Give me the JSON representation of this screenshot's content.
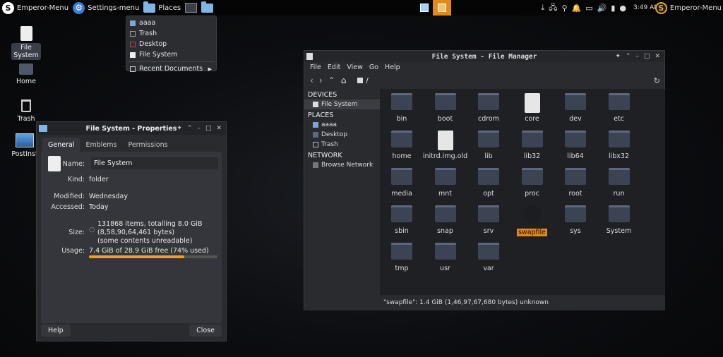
{
  "panel": {
    "emperor_menu_left": "Emperor-Menu",
    "settings_menu": "Settings-menu",
    "places": "Places",
    "clock": "3:49 AM",
    "emperor_menu_right": "Emperor-Menu",
    "accent": "#e08a1e"
  },
  "places_menu": {
    "items": [
      "aaaa",
      "Trash",
      "Desktop",
      "File System"
    ],
    "recent": "Recent Documents"
  },
  "desktop": {
    "icons": [
      "File System",
      "Home",
      "Trash",
      "PostInst"
    ]
  },
  "props": {
    "title": "File System - Properties",
    "tabs": [
      "General",
      "Emblems",
      "Permissions"
    ],
    "name_label": "Name:",
    "name_value": "File System",
    "kind_label": "Kind:",
    "kind_value": "folder",
    "modified_label": "Modified:",
    "modified_value": "Wednesday",
    "accessed_label": "Accessed:",
    "accessed_value": "Today",
    "size_label": "Size:",
    "size_line1": "131868 items, totalling 8.0 GiB",
    "size_line2": "(8,58,90,64,461 bytes)",
    "size_line3": "(some contents unreadable)",
    "usage_label": "Usage:",
    "usage_value": "7.4 GiB of 28.9 GiB free (74% used)",
    "usage_fraction": 0.74,
    "help": "Help",
    "close": "Close"
  },
  "fm": {
    "title": "File System - File Manager",
    "menus": [
      "File",
      "Edit",
      "View",
      "Go",
      "Help"
    ],
    "path": "/",
    "sidebar": {
      "devices_header": "DEVICES",
      "file_system": "File System",
      "places_header": "PLACES",
      "aaaa": "aaaa",
      "desktop": "Desktop",
      "trash": "Trash",
      "network_header": "NETWORK",
      "browse_network": "Browse Network"
    },
    "items": [
      "bin",
      "boot",
      "cdrom",
      "core",
      "dev",
      "etc",
      "home",
      "initrd.img.old",
      "lib",
      "lib32",
      "lib64",
      "libx32",
      "media",
      "mnt",
      "opt",
      "proc",
      "root",
      "run",
      "sbin",
      "snap",
      "srv",
      "swapfile",
      "sys",
      "System",
      "tmp",
      "usr",
      "var"
    ],
    "status": "\"swapfile\": 1.4 GiB (1,46,97,67,680 bytes) unknown"
  }
}
